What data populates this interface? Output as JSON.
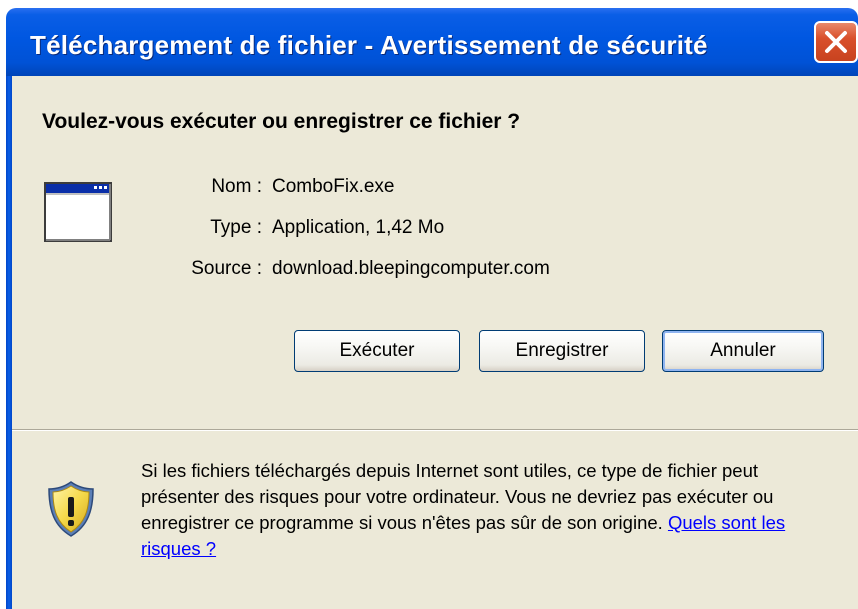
{
  "window": {
    "title": "Téléchargement de fichier - Avertissement de sécurité"
  },
  "dialog": {
    "heading": "Voulez-vous exécuter ou enregistrer ce fichier ?",
    "file": {
      "name_label": "Nom :",
      "name_value": "ComboFix.exe",
      "type_label": "Type :",
      "type_value": "Application, 1,42 Mo",
      "source_label": "Source :",
      "source_value": "download.bleepingcomputer.com"
    },
    "buttons": {
      "run": "Exécuter",
      "save": "Enregistrer",
      "cancel": "Annuler"
    },
    "warning": {
      "text": "Si les fichiers téléchargés depuis Internet sont utiles, ce type de fichier peut présenter des risques pour votre ordinateur. Vous ne devriez pas exécuter ou enregistrer ce programme si vous n'êtes pas sûr de son origine. ",
      "link": "Quels sont les risques ?"
    }
  },
  "icons": {
    "close": "close-icon",
    "file": "application-window-icon",
    "shield": "security-shield-warning-icon"
  },
  "colors": {
    "titlebar": "#0055e5",
    "close_button": "#d9502b",
    "dialog_background": "#ece9d8",
    "link": "#0000ff",
    "shield_yellow": "#f5d94a"
  }
}
